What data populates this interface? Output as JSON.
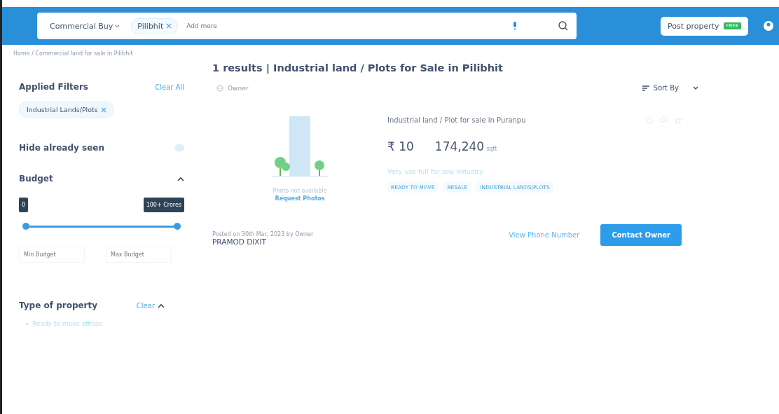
{
  "header": {
    "search": {
      "category": "Commercial Buy",
      "chips": [
        "Pilibhit"
      ],
      "placeholder": "Add more"
    },
    "post_property": {
      "label": "Post property",
      "badge": "FREE"
    }
  },
  "breadcrumb": "Home / Commercial land for sale in Pilibhit",
  "sidebar": {
    "applied_filters": {
      "title": "Applied Filters",
      "clear": "Clear All",
      "chips": [
        "Industrial Lands/Plots"
      ]
    },
    "hide_seen": {
      "label": "Hide already seen",
      "on": false
    },
    "budget": {
      "title": "Budget",
      "expanded": true,
      "min_label": "0",
      "max_label": "100+ Crores",
      "level": 1,
      "min_placeholder": "Min Budget",
      "max_placeholder": "Max Budget"
    },
    "type_of_property": {
      "title": "Type of property",
      "clear": "Clear",
      "expanded": true,
      "options": [
        "Ready to move offices"
      ]
    }
  },
  "results": {
    "heading": "1 results | Industrial land / Plots for Sale in Pilibhit",
    "posted_by_filter": "Owner",
    "sort": "Sort By"
  },
  "listing": {
    "photo_text": "Photo not available",
    "request_photos": "Request Photos",
    "title": "Industrial land / Plot for sale in Puranpu",
    "price": "₹ 10",
    "area": "174,240",
    "area_unit": "sqft",
    "description": "Very use full for any industry",
    "tags": [
      "READY TO MOVE",
      "RESALE",
      "INDUSTRIAL LANDS/PLOTS"
    ],
    "posted": "Posted on 30th Mar, 2023 by Owner",
    "owner": "PRAMOD DIXIT",
    "view_phone": "View Phone Number",
    "contact": "Contact Owner"
  }
}
